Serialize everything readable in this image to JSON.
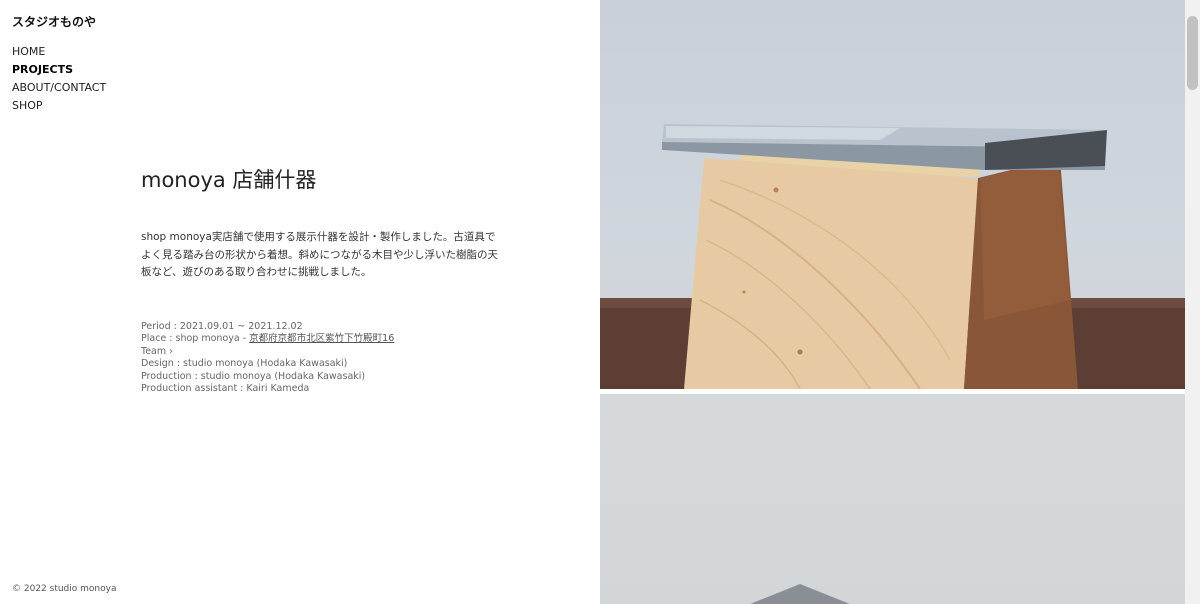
{
  "site": {
    "brand": "スタジオものや",
    "footer": "© 2022 studio monoya"
  },
  "nav": {
    "items": [
      {
        "label": "HOME"
      },
      {
        "label": "PROJECTS",
        "active": true
      },
      {
        "label": "ABOUT/CONTACT"
      },
      {
        "label": "SHOP"
      }
    ]
  },
  "project": {
    "title": "monoya 店舗什器",
    "description": "shop monoya実店舗で使用する展示什器を設計・製作しました。古道具でよく見る踏み台の形状から着想。斜めにつながる木目や少し浮いた樹脂の天板など、遊びのある取り合わせに挑戦しました。",
    "period": "Period : 2021.09.01 ~ 2021.12.02",
    "place_prefix": "Place : shop monoya - ",
    "place_link": "京都府京都市北区紫竹下竹殿町16",
    "team": "Team ›",
    "design": "Design : studio monoya (Hodaka Kawasaki)",
    "production": "Production : studio monoya (Hodaka Kawasaki)",
    "assistant": "Production assistant : Kairi Kameda"
  },
  "colors": {
    "accent": "#000000",
    "text": "#222222",
    "meta": "#666666"
  }
}
